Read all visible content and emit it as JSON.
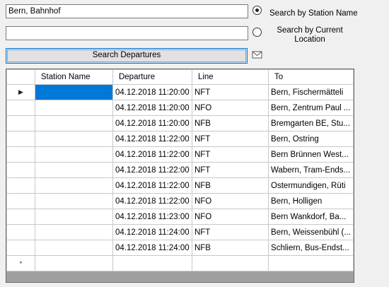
{
  "search": {
    "station_value": "Bern, Bahnhof",
    "location_value": "",
    "radio_station_label": "Search by Station Name",
    "radio_location_label": "Search by Current Location",
    "station_selected": true,
    "button_label": "Search Departures",
    "mail_icon": "envelope-icon"
  },
  "grid": {
    "columns": [
      "Station Name",
      "Departure",
      "Line",
      "To"
    ],
    "rows": [
      {
        "station": "",
        "departure": "04.12.2018 11:20:00",
        "line": "NFT",
        "to": "Bern, Fischermätteli"
      },
      {
        "station": "",
        "departure": "04.12.2018 11:20:00",
        "line": "NFO",
        "to": "Bern, Zentrum Paul ..."
      },
      {
        "station": "",
        "departure": "04.12.2018 11:20:00",
        "line": "NFB",
        "to": "Bremgarten BE, Stu..."
      },
      {
        "station": "",
        "departure": "04.12.2018 11:22:00",
        "line": "NFT",
        "to": "Bern, Ostring"
      },
      {
        "station": "",
        "departure": "04.12.2018 11:22:00",
        "line": "NFT",
        "to": "Bern Brünnen West..."
      },
      {
        "station": "",
        "departure": "04.12.2018 11:22:00",
        "line": "NFT",
        "to": "Wabern, Tram-Ends..."
      },
      {
        "station": "",
        "departure": "04.12.2018 11:22:00",
        "line": "NFB",
        "to": "Ostermundigen, Rüti"
      },
      {
        "station": "",
        "departure": "04.12.2018 11:22:00",
        "line": "NFO",
        "to": "Bern, Holligen"
      },
      {
        "station": "",
        "departure": "04.12.2018 11:23:00",
        "line": "NFO",
        "to": "Bern Wankdorf, Ba..."
      },
      {
        "station": "",
        "departure": "04.12.2018 11:24:00",
        "line": "NFT",
        "to": "Bern, Weissenbühl (..."
      },
      {
        "station": "",
        "departure": "04.12.2018 11:24:00",
        "line": "NFB",
        "to": "Schliern, Bus-Endst..."
      }
    ],
    "current_row_marker": "▶",
    "new_row_marker": "*"
  }
}
